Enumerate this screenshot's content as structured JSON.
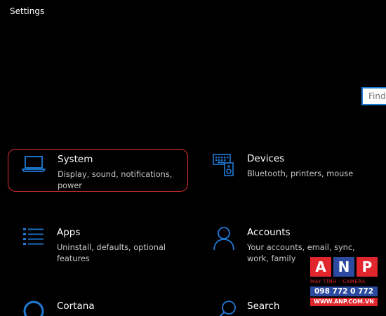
{
  "window": {
    "title": "Settings"
  },
  "search": {
    "placeholder": "Find"
  },
  "accent_color": "#1f7ad6",
  "selection_color": "#e03131",
  "tiles": [
    {
      "label": "System",
      "description": "Display, sound, notifications, power",
      "icon": "laptop-icon",
      "selected": true
    },
    {
      "label": "Devices",
      "description": "Bluetooth, printers, mouse",
      "icon": "keyboard-speaker-icon",
      "selected": false
    },
    {
      "label": "Apps",
      "description": "Uninstall, defaults, optional features",
      "icon": "apps-list-icon",
      "selected": false
    },
    {
      "label": "Accounts",
      "description": "Your accounts, email, sync, work, family",
      "icon": "person-icon",
      "selected": false
    },
    {
      "label": "Cortana",
      "description": "",
      "icon": "cortana-circle-icon",
      "selected": false
    },
    {
      "label": "Search",
      "description": "",
      "icon": "magnifier-icon",
      "selected": false
    }
  ],
  "watermark": {
    "letters": [
      "A",
      "N",
      "P"
    ],
    "tagline": "MÁY TÍNH - CAMERA",
    "phone": "098 772 0 772",
    "url": "WWW.ANP.COM.VN"
  }
}
